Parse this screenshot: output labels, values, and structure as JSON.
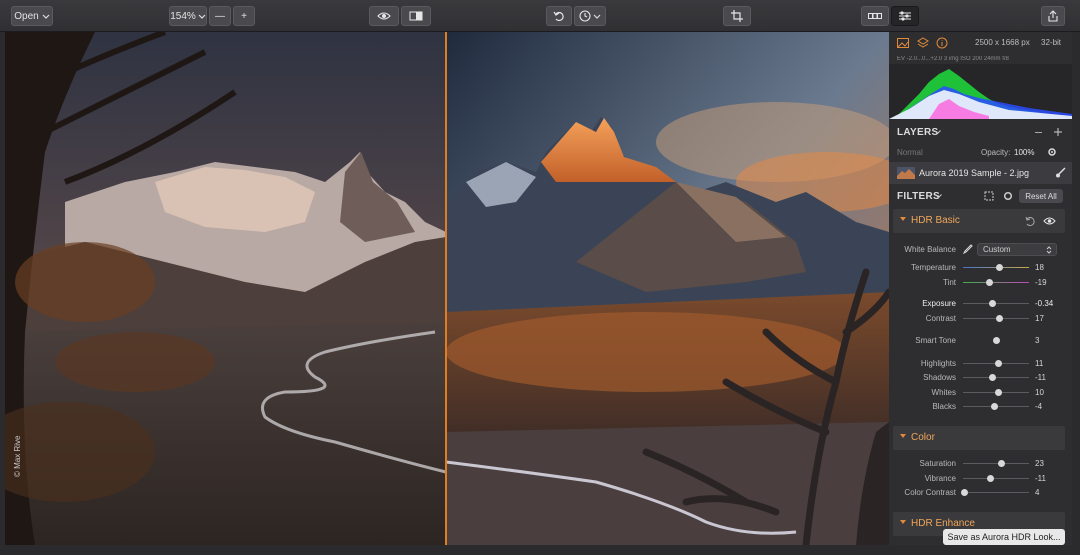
{
  "toolbar": {
    "open_label": "Open",
    "zoom_label": "154%",
    "zoom_out_label": "—",
    "zoom_in_label": "+"
  },
  "canvas": {
    "credit": "© Max Rive"
  },
  "image_info": {
    "dimensions": "2500 x 1668 px",
    "bit_depth": "32-bit",
    "exif": "EV -2.0...0...+2.0    3 img   ISO 200    24mm    f/8"
  },
  "layers": {
    "title": "LAYERS",
    "blend_mode": "Normal",
    "opacity_label": "Opacity:",
    "opacity_value": "100%",
    "item_name": "Aurora 2019 Sample - 2.jpg"
  },
  "filters": {
    "title": "FILTERS",
    "reset_label": "Reset All",
    "hdr_basic": {
      "title": "HDR Basic",
      "white_balance_label": "White Balance",
      "white_balance_value": "Custom",
      "temperature": {
        "label": "Temperature",
        "value": "18",
        "position": 0.56
      },
      "tint": {
        "label": "Tint",
        "value": "-19",
        "position": 0.4
      },
      "exposure": {
        "label": "Exposure",
        "value": "-0.34",
        "position": 0.44
      },
      "contrast": {
        "label": "Contrast",
        "value": "17",
        "position": 0.56
      },
      "smart_tone": {
        "label": "Smart Tone",
        "value": "3",
        "position": 0.51
      },
      "highlights": {
        "label": "Highlights",
        "value": "11",
        "position": 0.54
      },
      "shadows": {
        "label": "Shadows",
        "value": "-11",
        "position": 0.44
      },
      "whites": {
        "label": "Whites",
        "value": "10",
        "position": 0.54
      },
      "blacks": {
        "label": "Blacks",
        "value": "-4",
        "position": 0.47
      }
    },
    "color": {
      "title": "Color",
      "saturation": {
        "label": "Saturation",
        "value": "23",
        "position": 0.59
      },
      "vibrance": {
        "label": "Vibrance",
        "value": "-11",
        "position": 0.42
      },
      "color_contrast": {
        "label": "Color Contrast",
        "value": "4",
        "position": 0.02
      }
    },
    "hdr_enhance": {
      "title": "HDR Enhance"
    }
  },
  "footer": {
    "save_look_label": "Save as Aurora HDR Look..."
  },
  "colors": {
    "accent": "#e07c22",
    "panel_bg": "#2e2e30",
    "toolbar_bg": "#343437"
  }
}
